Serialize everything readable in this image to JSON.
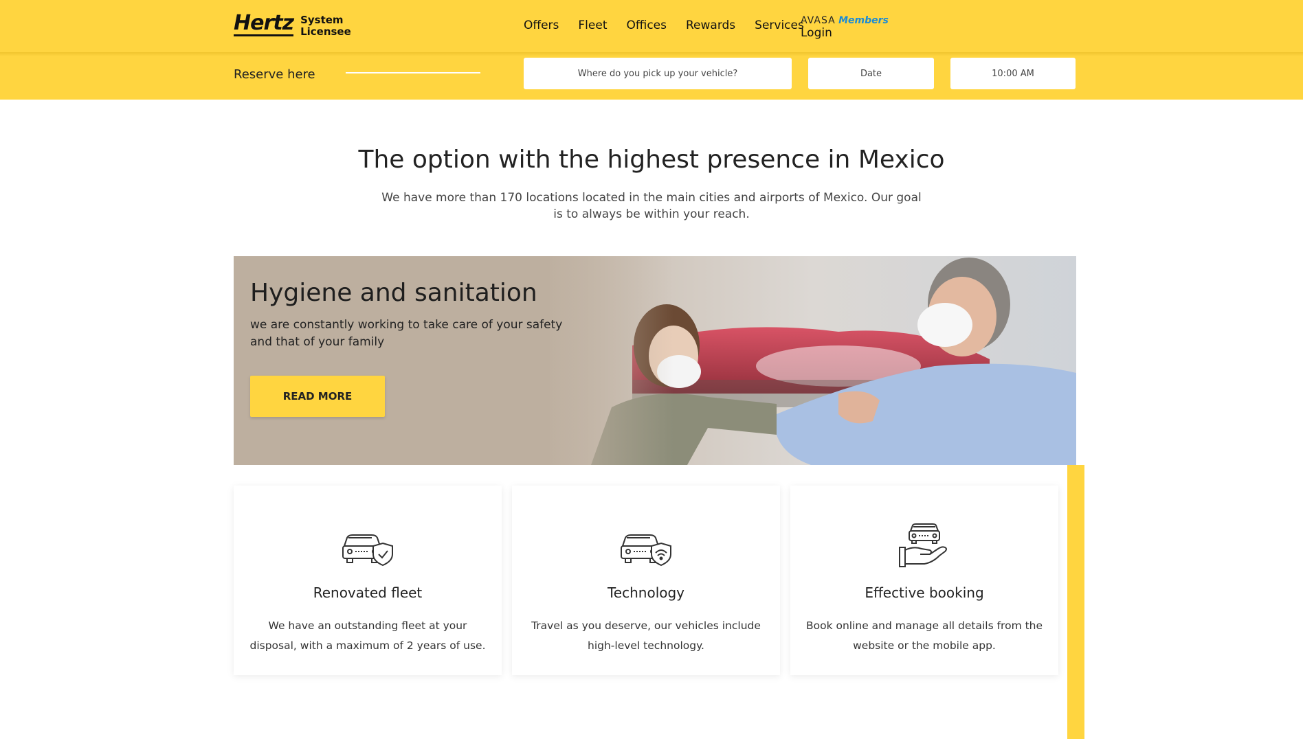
{
  "header": {
    "logo_word": "Hertz",
    "logo_sub_line1": "System",
    "logo_sub_line2": "Licensee",
    "nav": [
      "Offers",
      "Fleet",
      "Offices",
      "Rewards",
      "Services"
    ],
    "members_brand": "AVASA",
    "members_label": "Members",
    "login_label": "Login"
  },
  "reservation": {
    "label": "Reserve here",
    "pickup_placeholder": "Where do you pick up your vehicle?",
    "date_placeholder": "Date",
    "time_value": "10:00 AM"
  },
  "intro": {
    "title": "The option with the highest presence in Mexico",
    "text": "We have more than 170 locations located in the main cities and airports of Mexico. Our goal is to always be within your reach."
  },
  "banner": {
    "title": "Hygiene and sanitation",
    "text": "we are constantly working to take care of your safety and that of your family",
    "button_label": "READ MORE"
  },
  "features": [
    {
      "icon": "car-shield-check-icon",
      "title": "Renovated fleet",
      "text": "We have an outstanding fleet at your disposal, with a maximum of 2 years of use."
    },
    {
      "icon": "car-shield-wifi-icon",
      "title": "Technology",
      "text": "Travel as you deserve, our vehicles include high-level technology."
    },
    {
      "icon": "car-hand-icon",
      "title": "Effective booking",
      "text": "Book online and manage all details from the website or the mobile app."
    }
  ],
  "colors": {
    "brand_yellow": "#FFD540",
    "members_blue": "#1a8bd6",
    "banner_beige": "#bdaf9f"
  }
}
